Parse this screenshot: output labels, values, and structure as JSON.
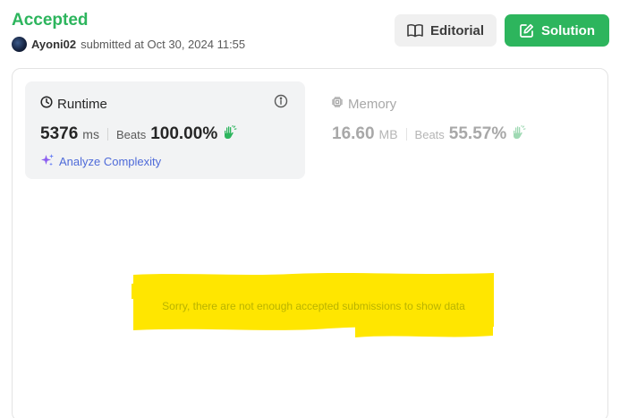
{
  "header": {
    "status": "Accepted",
    "username": "Ayoni02",
    "submitted_text": "submitted at Oct 30, 2024 11:55",
    "editorial_label": "Editorial",
    "solution_label": "Solution"
  },
  "runtime": {
    "title": "Runtime",
    "value": "5376",
    "unit": "ms",
    "beats_label": "Beats",
    "beats_value": "100.00%",
    "analyze_label": "Analyze Complexity"
  },
  "memory": {
    "title": "Memory",
    "value": "16.60",
    "unit": "MB",
    "beats_label": "Beats",
    "beats_value": "55.57%"
  },
  "chart": {
    "message": "Sorry, there are not enough accepted submissions to show data"
  },
  "colors": {
    "accepted": "#2db55d",
    "solution_button": "#2db55d",
    "analyze": "#4f6bd9",
    "highlight": "#ffe600"
  },
  "icons": {
    "editorial": "book-open-icon",
    "solution": "edit-icon",
    "runtime": "clock-icon",
    "memory": "chip-icon",
    "info": "info-icon",
    "beats": "hand-icon",
    "analyze": "sparkle-icon"
  }
}
